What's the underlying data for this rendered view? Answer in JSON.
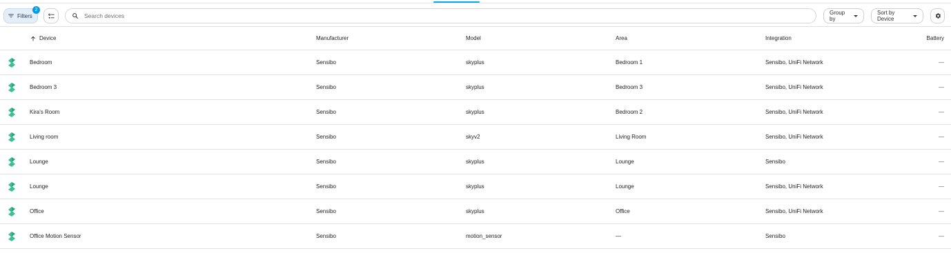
{
  "toolbar": {
    "filters_label": "Filters",
    "filters_count": "2",
    "search_placeholder": "Search devices",
    "group_by_label": "Group by",
    "sort_by_label": "Sort by Device",
    "accent_color": "#03a9f4"
  },
  "columns": {
    "device": "Device",
    "manufacturer": "Manufacturer",
    "model": "Model",
    "area": "Area",
    "integration": "Integration",
    "battery": "Battery"
  },
  "rows": [
    {
      "name": "Bedroom",
      "manufacturer": "Sensibo",
      "model": "skyplus",
      "area": "Bedroom 1",
      "integration": "Sensibo, UniFi Network",
      "battery": "—"
    },
    {
      "name": "Bedroom 3",
      "manufacturer": "Sensibo",
      "model": "skyplus",
      "area": "Bedroom 3",
      "integration": "Sensibo, UniFi Network",
      "battery": "—"
    },
    {
      "name": "Kira's Room",
      "manufacturer": "Sensibo",
      "model": "skyplus",
      "area": "Bedroom 2",
      "integration": "Sensibo, UniFi Network",
      "battery": "—"
    },
    {
      "name": "Living room",
      "manufacturer": "Sensibo",
      "model": "skyv2",
      "area": "Living Room",
      "integration": "Sensibo, UniFi Network",
      "battery": "—"
    },
    {
      "name": "Lounge",
      "manufacturer": "Sensibo",
      "model": "skyplus",
      "area": "Lounge",
      "integration": "Sensibo",
      "battery": "—"
    },
    {
      "name": "Lounge",
      "manufacturer": "Sensibo",
      "model": "skyplus",
      "area": "Lounge",
      "integration": "Sensibo, UniFi Network",
      "battery": "—"
    },
    {
      "name": "Office",
      "manufacturer": "Sensibo",
      "model": "skyplus",
      "area": "Office",
      "integration": "Sensibo, UniFi Network",
      "battery": "—"
    },
    {
      "name": "Office Motion Sensor",
      "manufacturer": "Sensibo",
      "model": "motion_sensor",
      "area": "—",
      "integration": "Sensibo",
      "battery": "—"
    }
  ],
  "icons": {
    "device_icon": "sensibo-logo-icon",
    "device_icon_color": "#3bbf95"
  }
}
